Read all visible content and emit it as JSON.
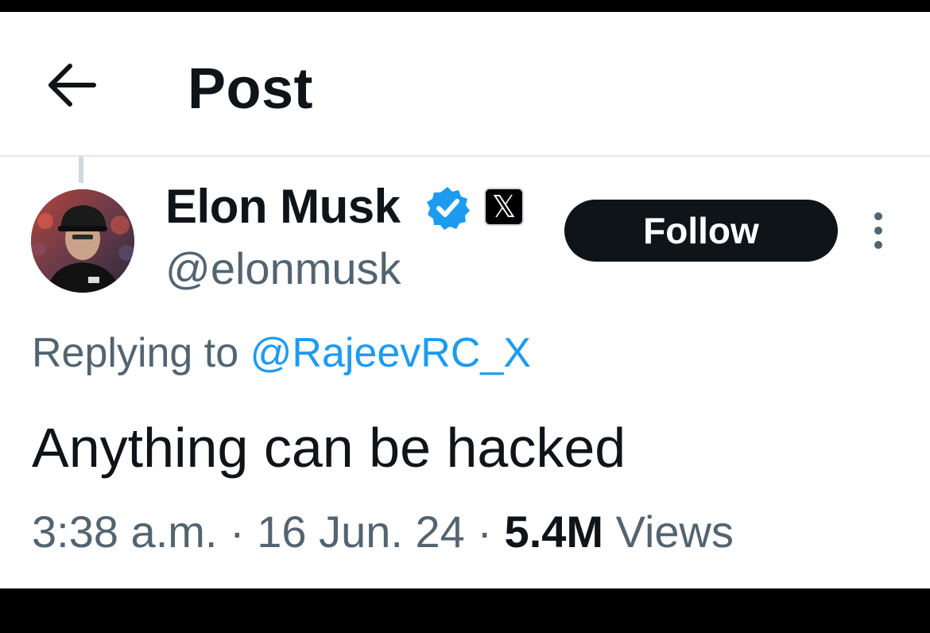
{
  "header": {
    "back_icon": "arrow-left-icon",
    "title": "Post"
  },
  "author": {
    "display_name": "Elon Musk",
    "handle": "@elonmusk",
    "verified_icon": "verified-badge-icon",
    "verified_color": "#1d9bf0",
    "affiliate_badge_label": "𝕏"
  },
  "actions": {
    "follow_label": "Follow",
    "more_icon": "more-options-icon"
  },
  "reply_context": {
    "prefix": "Replying to ",
    "mention": "@RajeevRC_X"
  },
  "post": {
    "text": "Anything can be hacked"
  },
  "meta": {
    "time": "3:38 a.m.",
    "separator_1": " · ",
    "date": "16 Jun. 24",
    "separator_2": " · ",
    "views_count": "5.4M",
    "views_label": " Views"
  },
  "colors": {
    "text_primary": "#0f1419",
    "text_secondary": "#536471",
    "link": "#1d9bf0",
    "follow_button_bg": "#0f1419"
  }
}
